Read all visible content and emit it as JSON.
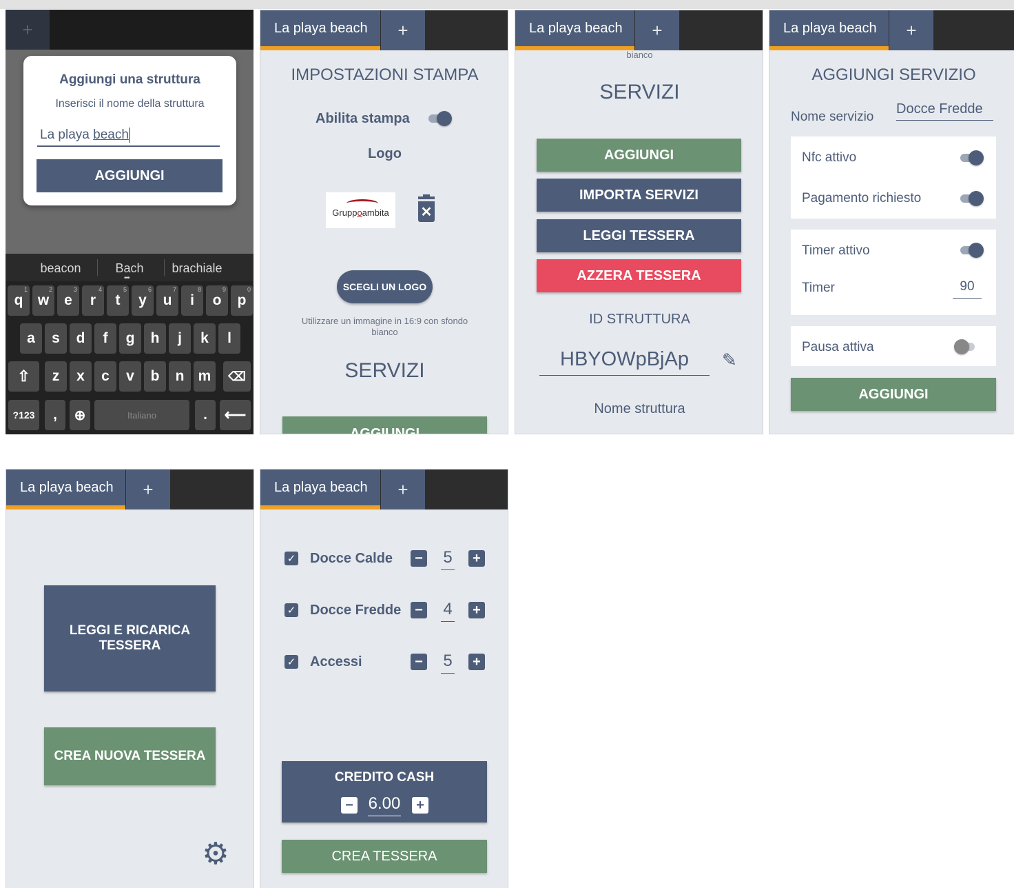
{
  "colors": {
    "navy": "#4d5d79",
    "green": "#6b9272",
    "red": "#e84a5f",
    "orange": "#ef9f22",
    "panel_bg": "#e6e9ed"
  },
  "tabs": {
    "active": "La playa beach",
    "add": "+"
  },
  "screen1": {
    "dialog_title": "Aggiungi una struttura",
    "dialog_subtitle": "Inserisci il nome della struttura",
    "input_value_prefix": "La playa ",
    "input_value_underlined": "beach",
    "add_button": "AGGIUNGI",
    "suggestions": [
      "beacon",
      "Bach",
      "brachiale"
    ],
    "row1": [
      {
        "k": "q",
        "h": "1"
      },
      {
        "k": "w",
        "h": "2"
      },
      {
        "k": "e",
        "h": "3"
      },
      {
        "k": "r",
        "h": "4"
      },
      {
        "k": "t",
        "h": "5"
      },
      {
        "k": "y",
        "h": "6"
      },
      {
        "k": "u",
        "h": "7"
      },
      {
        "k": "i",
        "h": "8"
      },
      {
        "k": "o",
        "h": "9"
      },
      {
        "k": "p",
        "h": "0"
      }
    ],
    "row2": [
      "a",
      "s",
      "d",
      "f",
      "g",
      "h",
      "j",
      "k",
      "l"
    ],
    "row3": [
      "z",
      "x",
      "c",
      "v",
      "b",
      "n",
      "m"
    ],
    "key_123": "?123",
    "key_comma": ",",
    "space_label": "Italiano",
    "key_period": "."
  },
  "screen2": {
    "title": "IMPOSTAZIONI STAMPA",
    "enable_print_label": "Abilita stampa",
    "enable_print_on": true,
    "logo_label": "Logo",
    "logo_text_1": "Grupp",
    "logo_text_2": "o",
    "logo_text_3": "ambita",
    "choose_logo": "SCEGLI UN LOGO",
    "hint": "Utilizzare un immagine in 16:9 con sfondo bianco",
    "services_title": "SERVIZI",
    "add_button": "AGGIUNGI"
  },
  "screen3": {
    "top_hint": "bianco",
    "services_title": "SERVIZI",
    "add_button": "AGGIUNGI",
    "import_button": "IMPORTA SERVIZI",
    "read_button": "LEGGI TESSERA",
    "reset_button": "AZZERA TESSERA",
    "id_label": "ID STRUTTURA",
    "id_value": "HBYOWpBjAp",
    "name_label": "Nome struttura"
  },
  "screen4": {
    "title": "AGGIUNGI SERVIZIO",
    "name_label": "Nome servizio",
    "name_value": "Docce Fredde",
    "nfc_label": "Nfc attivo",
    "payment_label": "Pagamento richiesto",
    "timer_active_label": "Timer attivo",
    "timer_label": "Timer",
    "timer_value": "90",
    "pause_label": "Pausa attiva",
    "add_button": "AGGIUNGI"
  },
  "screen5": {
    "read_button_line1": "LEGGI E RICARICA",
    "read_button_line2": "TESSERA",
    "create_button": "CREA NUOVA TESSERA"
  },
  "screen6": {
    "services": [
      {
        "name": "Docce Calde",
        "qty": "5"
      },
      {
        "name": "Docce Fredde",
        "qty": "4"
      },
      {
        "name": "Accessi",
        "qty": "5"
      }
    ],
    "credit_label": "CREDITO CASH",
    "credit_value": "6.00",
    "create_button": "CREA TESSERA"
  }
}
